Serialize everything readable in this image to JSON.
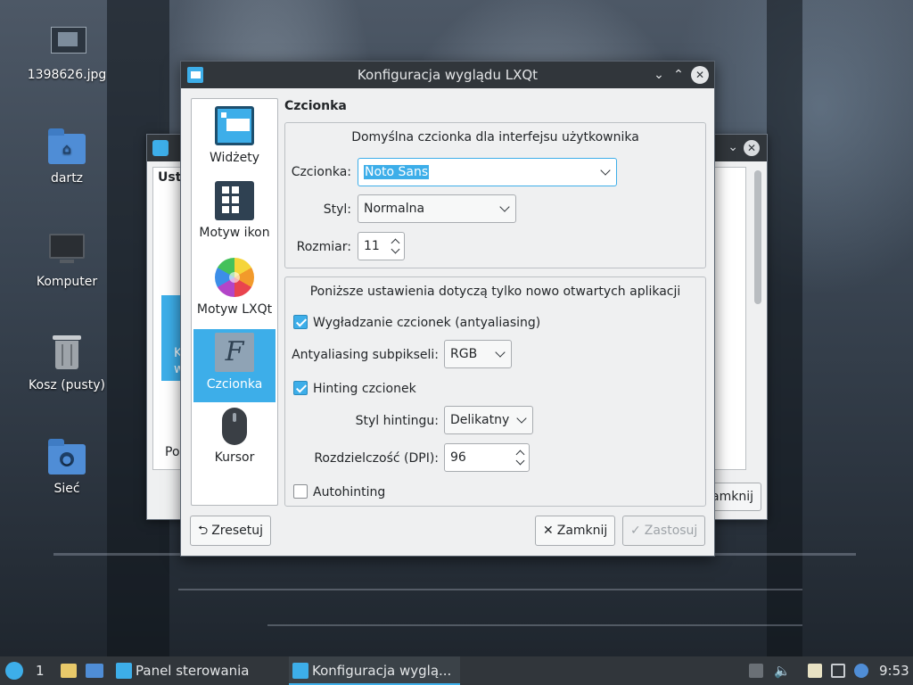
{
  "desktop": {
    "icons": [
      {
        "label": "1398626.jpg"
      },
      {
        "label": "dartz"
      },
      {
        "label": "Komputer"
      },
      {
        "label": "Kosz (pusty)"
      },
      {
        "label": "Sieć"
      }
    ]
  },
  "back_window": {
    "partial_label_top": "Ust",
    "partial_label_bottom": "Po",
    "tile_text_1": "K",
    "tile_text_2": "w",
    "close_button_partial": "amknij"
  },
  "dialog": {
    "title": "Konfiguracja wyglądu LXQt",
    "sidebar": [
      {
        "label": "Widżety",
        "icon": "widgets-icon"
      },
      {
        "label": "Motyw ikon",
        "icon": "icon-theme-icon"
      },
      {
        "label": "Motyw LXQt",
        "icon": "lxqt-theme-icon"
      },
      {
        "label": "Czcionka",
        "icon": "font-icon",
        "active": true
      },
      {
        "label": "Kursor",
        "icon": "cursor-icon"
      }
    ],
    "section_title": "Czcionka",
    "default_font": {
      "group_title": "Domyślna czcionka dla interfejsu użytkownika",
      "font_label": "Czcionka:",
      "font_value": "Noto Sans",
      "style_label": "Styl:",
      "style_value": "Normalna",
      "size_label": "Rozmiar:",
      "size_value": "11"
    },
    "new_apps": {
      "group_title": "Poniższe ustawienia dotyczą tylko nowo otwartych aplikacji",
      "antialias_label": "Wygładzanie czcionek (antyaliasing)",
      "antialias_checked": true,
      "subpixel_label": "Antyaliasing subpikseli:",
      "subpixel_value": "RGB",
      "hinting_label": "Hinting czcionek",
      "hinting_checked": true,
      "hint_style_label": "Styl hintingu:",
      "hint_style_value": "Delikatny",
      "dpi_label": "Rozdzielczość (DPI):",
      "dpi_value": "96",
      "autohint_label": "Autohinting",
      "autohint_checked": false
    },
    "buttons": {
      "reset": "Zresetuj",
      "close": "Zamknij",
      "apply": "Zastosuj"
    }
  },
  "taskbar": {
    "desktop_number": "1",
    "tasks": [
      {
        "label": "Panel sterowania"
      },
      {
        "label": "Konfiguracja wyglą..."
      }
    ],
    "clock": "9:53"
  },
  "colors": {
    "accent": "#3daee9",
    "titlebar": "#31363b",
    "window_bg": "#eff0f1"
  }
}
